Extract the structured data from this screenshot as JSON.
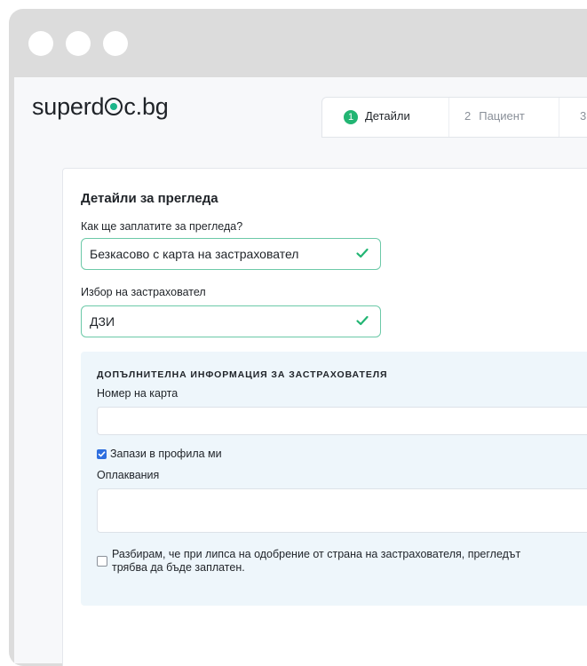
{
  "app": {
    "logo_prefix": "superd",
    "logo_suffix": "c.bg"
  },
  "steps": [
    {
      "number": "1",
      "label": "Детайли",
      "active": true
    },
    {
      "number": "2",
      "label": "Пациент",
      "active": false
    },
    {
      "number": "3",
      "label": "",
      "active": false
    }
  ],
  "form": {
    "title": "Детайли за прегледа",
    "payment_label": "Как ще заплатите за прегледа?",
    "payment_value": "Безкасово с карта на застраховател",
    "insurer_label": "Избор на застраховател",
    "insurer_value": "ДЗИ",
    "extra": {
      "title": "ДОПЪЛНИТЕЛНА ИНФОРМАЦИЯ ЗА ЗАСТРАХОВАТЕЛЯ",
      "card_number_label": "Номер на карта",
      "card_number_value": "",
      "save_profile_label": "Запази в профила ми",
      "save_profile_checked": true,
      "complaints_label": "Оплаквания",
      "complaints_value": "",
      "consent_line1": "Разбирам, че при липса на одобрение от страна на застрахователя, прегледът",
      "consent_line2": "трябва да бъде заплатен.",
      "consent_checked": false
    }
  },
  "colors": {
    "accent": "#22b573",
    "valid_border": "#6cc9a8",
    "panel_bg": "#eef6fb",
    "checkbox": "#2f6fdf",
    "window_chrome": "#dcdcdc"
  },
  "icons": {
    "valid": "check-icon",
    "logo_dot": "logo-o-dot-icon"
  }
}
